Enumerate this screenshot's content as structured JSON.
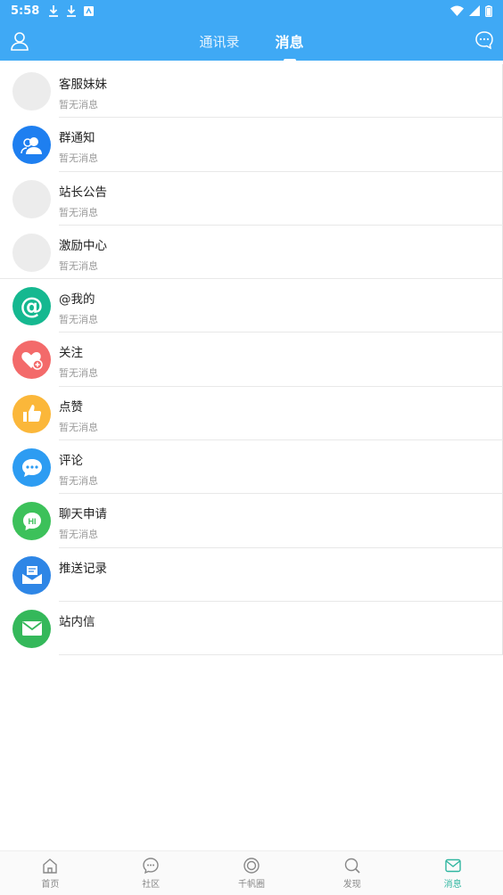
{
  "status_bar": {
    "time": "5:58"
  },
  "header": {
    "tabs": [
      {
        "label": "通讯录"
      },
      {
        "label": "消息"
      }
    ]
  },
  "messages": [
    {
      "title": "客服妹妹",
      "subtitle": "暂无消息",
      "icon": "placeholder-gray",
      "color": "#ececec"
    },
    {
      "title": "群通知",
      "subtitle": "暂无消息",
      "icon": "group-icon",
      "color": "#1e7ff0"
    },
    {
      "title": "站长公告",
      "subtitle": "暂无消息",
      "icon": "placeholder-gray",
      "color": "#ececec"
    },
    {
      "title": "激励中心",
      "subtitle": "暂无消息",
      "icon": "placeholder-gray",
      "color": "#ececec"
    },
    {
      "title": "@我的",
      "subtitle": "暂无消息",
      "icon": "at-icon",
      "color": "#15b890"
    },
    {
      "title": "关注",
      "subtitle": "暂无消息",
      "icon": "heart-plus-icon",
      "color": "#f36a6a"
    },
    {
      "title": "点赞",
      "subtitle": "暂无消息",
      "icon": "thumbs-up-icon",
      "color": "#fbb73a"
    },
    {
      "title": "评论",
      "subtitle": "暂无消息",
      "icon": "comment-icon",
      "color": "#2d9cf2"
    },
    {
      "title": "聊天申请",
      "subtitle": "暂无消息",
      "icon": "hi-bubble-icon",
      "color": "#3cc15a"
    },
    {
      "title": "推送记录",
      "subtitle": "",
      "icon": "push-record-icon",
      "color": "#2e86e6"
    },
    {
      "title": "站内信",
      "subtitle": "",
      "icon": "envelope-icon",
      "color": "#34b85a"
    }
  ],
  "bottom_nav": [
    {
      "label": "首页",
      "icon": "home-icon"
    },
    {
      "label": "社区",
      "icon": "community-icon"
    },
    {
      "label": "千帆圈",
      "icon": "circle-icon"
    },
    {
      "label": "发现",
      "icon": "search-icon"
    },
    {
      "label": "消息",
      "icon": "message-icon",
      "active": true
    }
  ],
  "colors": {
    "primary": "#3fa9f5",
    "nav_active": "#2fb6a0"
  }
}
